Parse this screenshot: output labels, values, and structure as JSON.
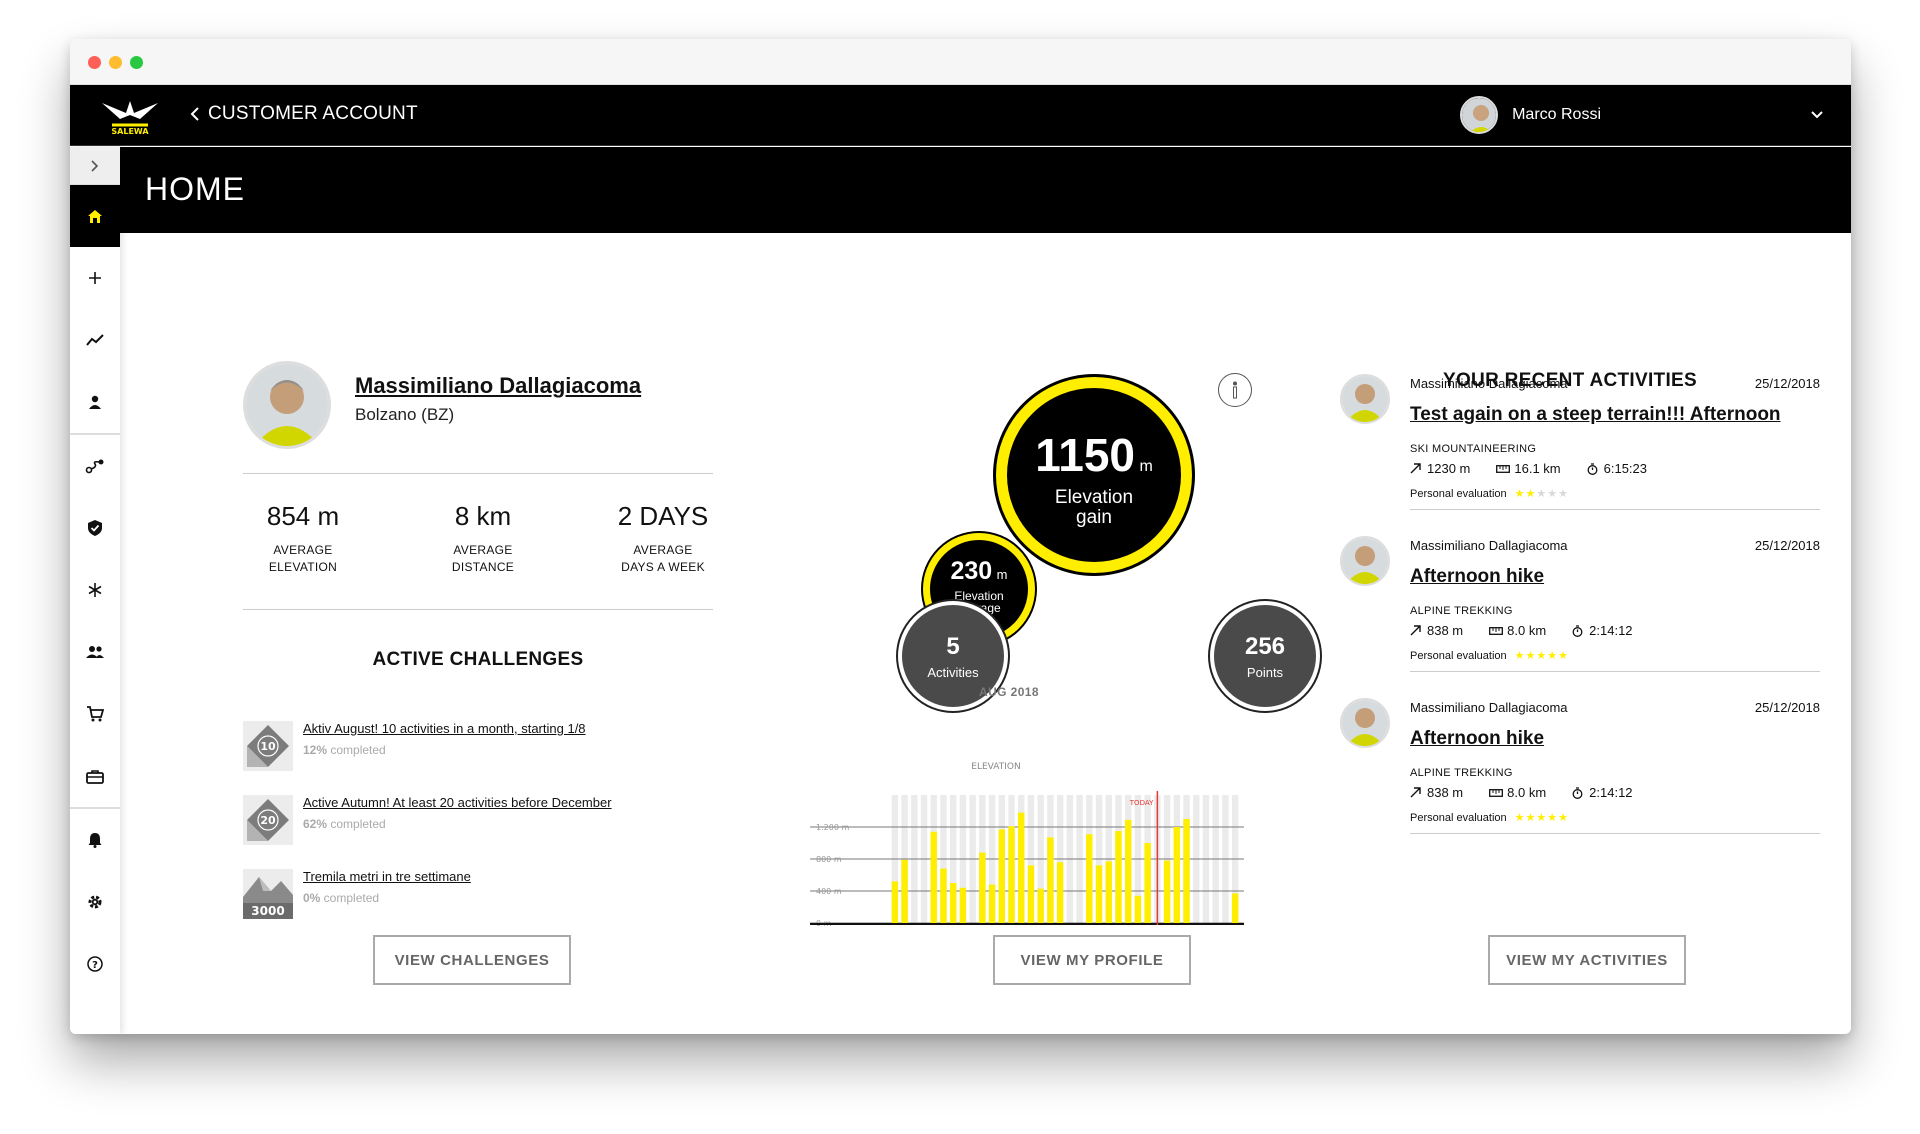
{
  "topbar": {
    "back_label": "CUSTOMER ACCOUNT",
    "user_name": "Marco Rossi"
  },
  "header": {
    "title": "HOME"
  },
  "profile": {
    "name": "Massimiliano Dallagiacoma",
    "location": "Bolzano (BZ)",
    "stats": [
      {
        "value": "854 m",
        "label1": "AVERAGE",
        "label2": "ELEVATION"
      },
      {
        "value": "8 km",
        "label1": "AVERAGE",
        "label2": "DISTANCE"
      },
      {
        "value": "2 DAYS",
        "label1": "AVERAGE",
        "label2": "DAYS A WEEK"
      }
    ]
  },
  "challenges": {
    "title": "ACTIVE CHALLENGES",
    "items": [
      {
        "title": "Aktiv August! 10 activities in a month, starting 1/8",
        "percent": "12%",
        "suffix": " completed",
        "badge": "10"
      },
      {
        "title": "Active Autumn! At least 20 activities before December",
        "percent": "62%",
        "suffix": " completed",
        "badge": "20"
      },
      {
        "title": "Tremila metri in tre settimane",
        "percent": "0%",
        "suffix": " completed",
        "badge": "3000"
      }
    ],
    "button": "VIEW CHALLENGES"
  },
  "summary": {
    "main_value": "1150",
    "main_unit": "m",
    "main_label1": "Elevation",
    "main_label2": "gain",
    "avg_value": "230",
    "avg_unit": "m",
    "avg_label1": "Elevation",
    "avg_label2": "average",
    "activities_value": "5",
    "activities_label": "Activities",
    "points_value": "256",
    "points_label": "Points",
    "period": "AUG 2018",
    "button": "VIEW MY PROFILE",
    "colors": {
      "accent": "#ffee00",
      "ring_dark": "#4a4a4a",
      "today_line": "#e53935"
    }
  },
  "chart_data": {
    "type": "bar",
    "title": "ELEVATION",
    "today_label": "TODAY",
    "y_ticks": [
      "1.200 m",
      "800 m",
      "400 m",
      "0 m"
    ],
    "ylim": [
      0,
      1600
    ],
    "grid": true,
    "today_index": 27,
    "values": [
      520,
      790,
      0,
      0,
      1140,
      680,
      500,
      440,
      0,
      880,
      480,
      1170,
      1210,
      1380,
      720,
      430,
      1070,
      760,
      0,
      0,
      1110,
      720,
      770,
      1150,
      1290,
      340,
      1000,
      0,
      780,
      1200,
      1300,
      0,
      0,
      0,
      0,
      370
    ]
  },
  "activities": {
    "title": "YOUR RECENT ACTIVITIES",
    "items": [
      {
        "user": "Massimiliano Dallagiacoma",
        "date": "25/12/2018",
        "title": "Test again on a steep terrain!!! Afternoon",
        "type": "SKI MOUNTAINEERING",
        "elev": "1230 m",
        "dist": "16.1 km",
        "time": "6:15:23",
        "eval_label": "Personal evaluation",
        "rating": 2
      },
      {
        "user": "Massimiliano Dallagiacoma",
        "date": "25/12/2018",
        "title": "Afternoon hike",
        "type": "ALPINE TREKKING",
        "elev": "838 m",
        "dist": "8.0 km",
        "time": "2:14:12",
        "eval_label": "Personal evaluation",
        "rating": 5
      },
      {
        "user": "Massimiliano Dallagiacoma",
        "date": "25/12/2018",
        "title": "Afternoon hike",
        "type": "ALPINE TREKKING",
        "elev": "838 m",
        "dist": "8.0 km",
        "time": "2:14:12",
        "eval_label": "Personal evaluation",
        "rating": 5
      }
    ],
    "button": "VIEW MY ACTIVITIES"
  }
}
